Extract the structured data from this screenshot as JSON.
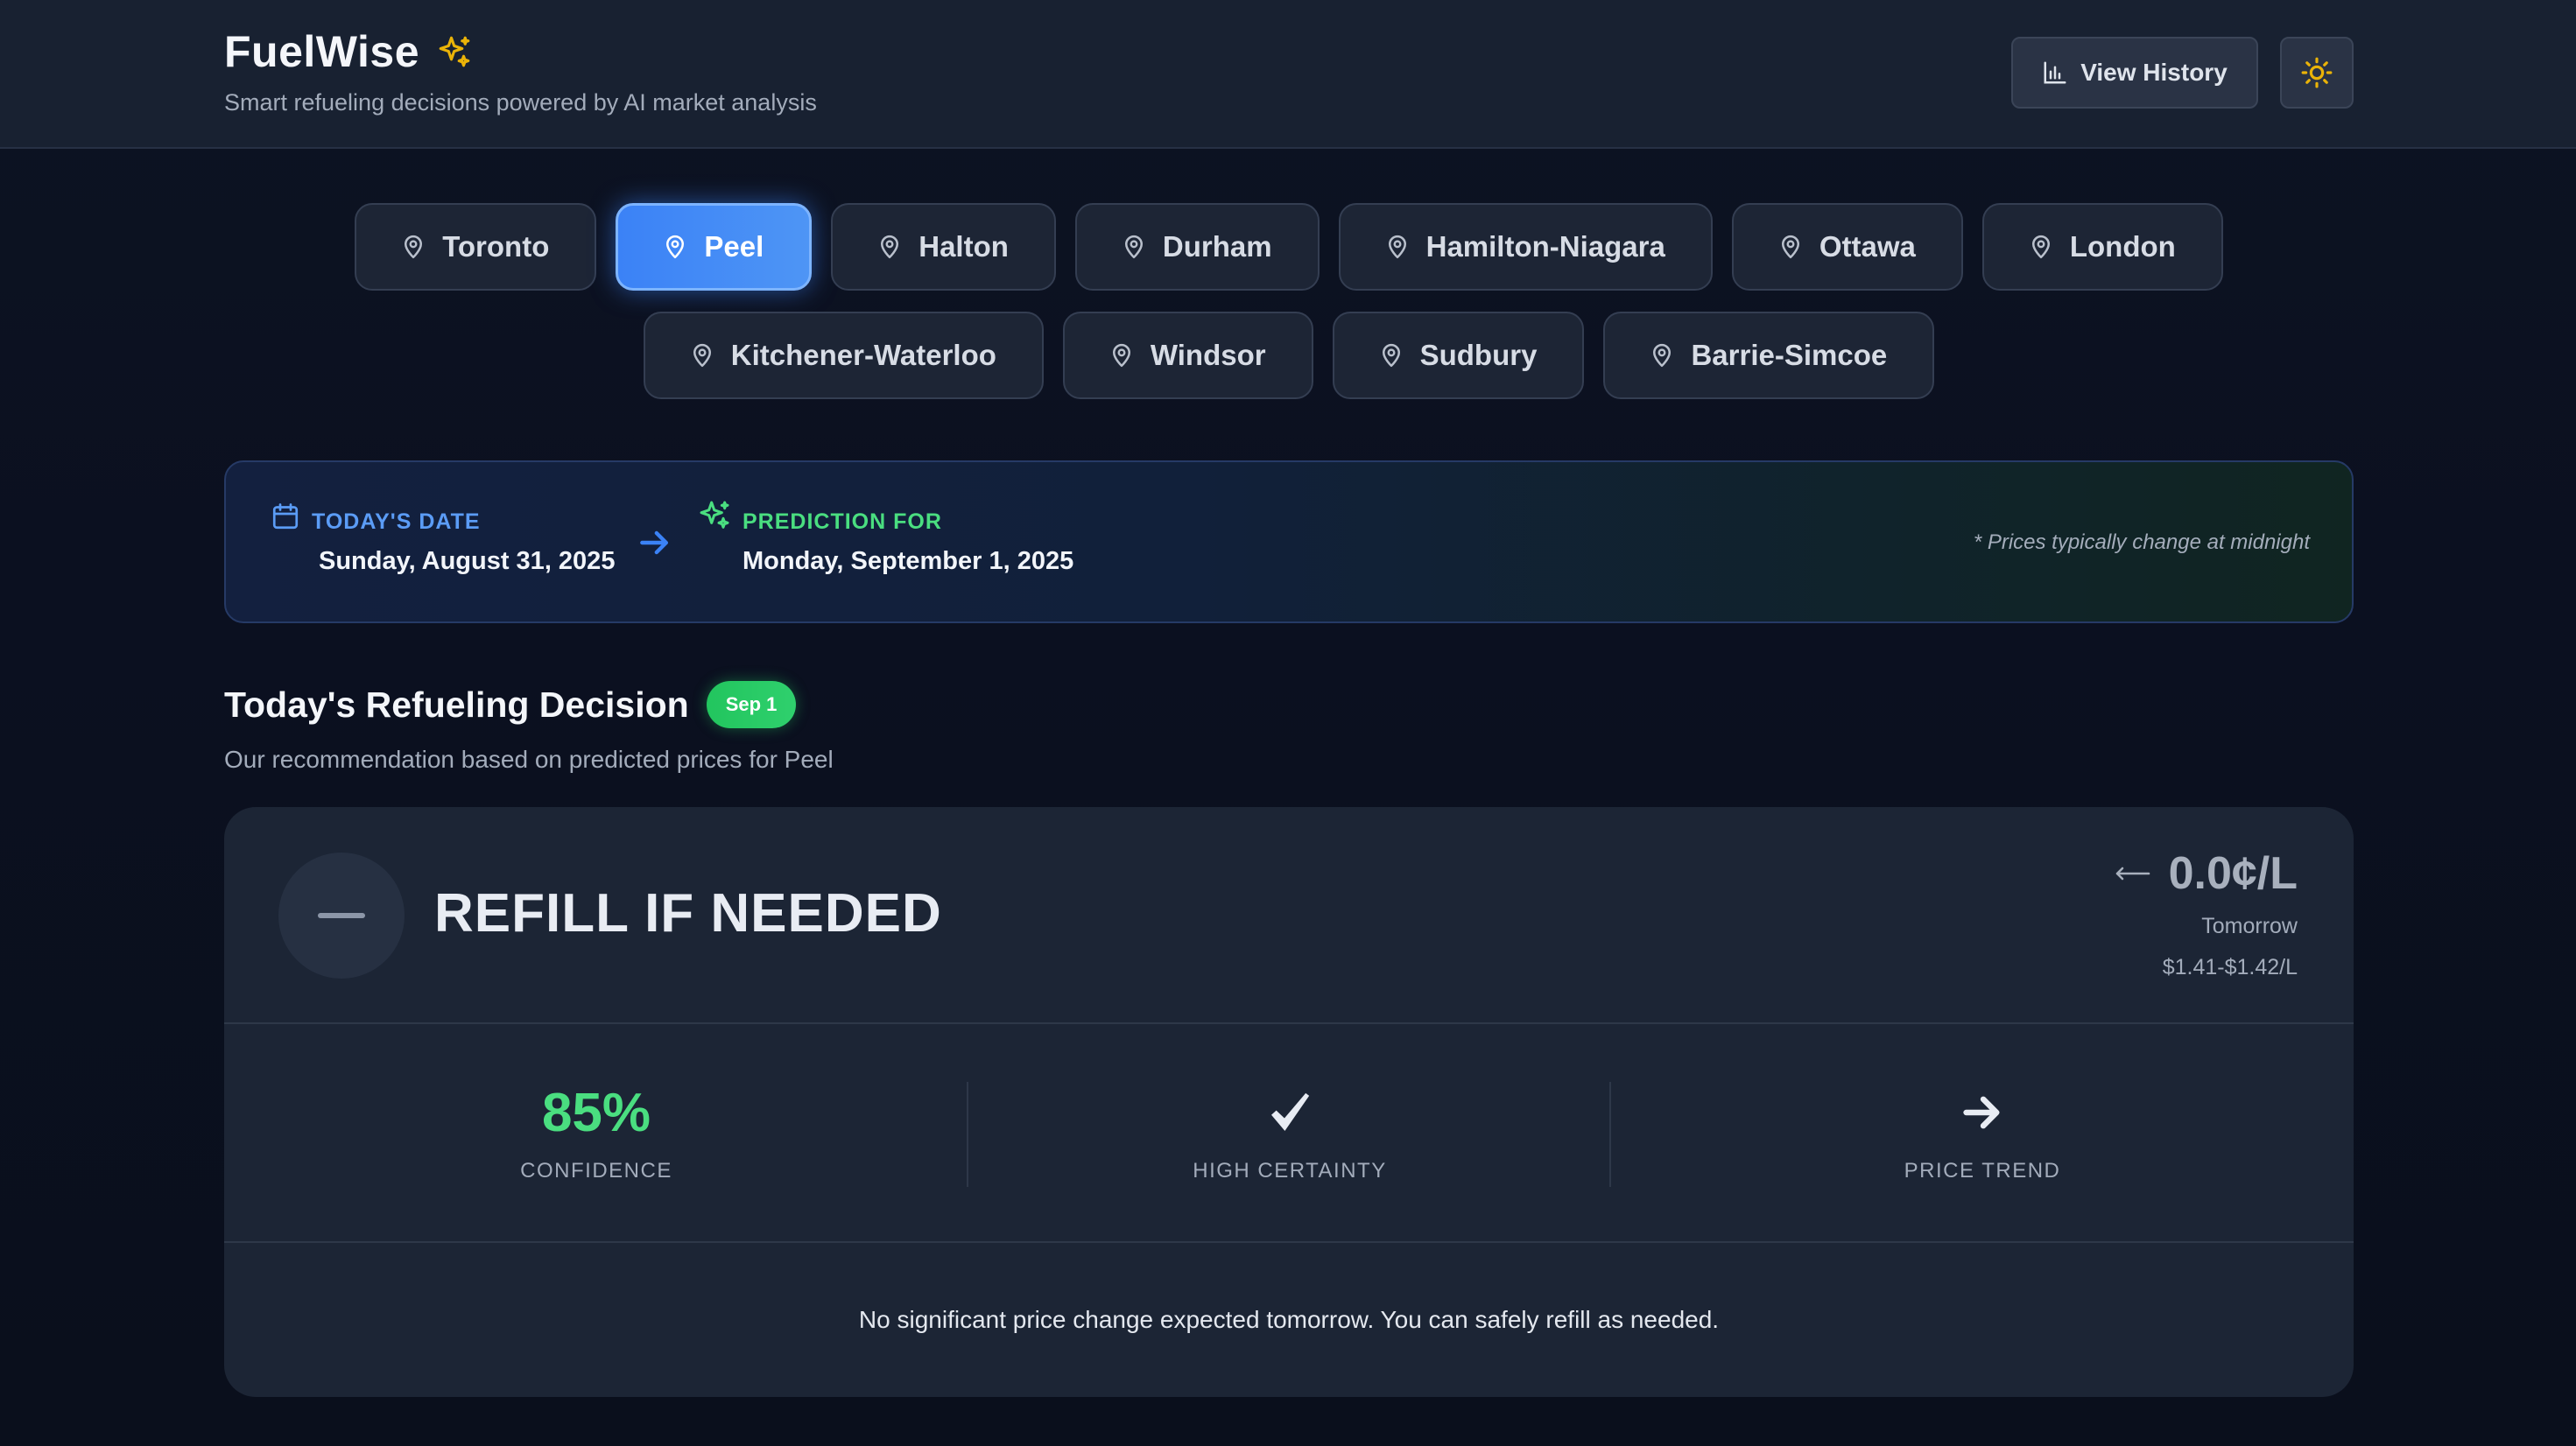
{
  "app": {
    "title": "FuelWise",
    "subtitle": "Smart refueling decisions powered by AI market analysis",
    "view_history_label": "View History",
    "accent_color": "#3b82f6",
    "spark_color": "#eab308",
    "theme_icon": "sun-icon"
  },
  "regions": {
    "row1": [
      "Toronto",
      "Peel",
      "Halton",
      "Durham",
      "Hamilton-Niagara",
      "Ottawa",
      "London"
    ],
    "row2": [
      "Kitchener-Waterloo",
      "Windsor",
      "Sudbury",
      "Barrie-Simcoe"
    ],
    "selected": "Peel",
    "icon": "map-pin-icon"
  },
  "date_banner": {
    "today_label": "TODAY'S DATE",
    "today_value": "Sunday, August 31, 2025",
    "prediction_label": "PREDICTION FOR",
    "prediction_value": "Monday, September 1, 2025",
    "note": "* Prices typically change at midnight"
  },
  "decision": {
    "section_title": "Today's Refueling Decision",
    "badge": "Sep 1",
    "subtitle": "Our recommendation based on predicted prices for Peel",
    "recommendation": "REFILL IF NEEDED",
    "price_change": "0.0¢/L",
    "price_when": "Tomorrow",
    "price_range": "$1.41-$1.42/L",
    "confidence_value": "85%",
    "confidence_label": "CONFIDENCE",
    "certainty_label": "HIGH CERTAINTY",
    "trend_label": "PRICE TREND",
    "summary": "No significant price change expected tomorrow. You can safely refill as needed.",
    "confidence_color": "#4ade80",
    "badge_color": "#22c55e"
  }
}
